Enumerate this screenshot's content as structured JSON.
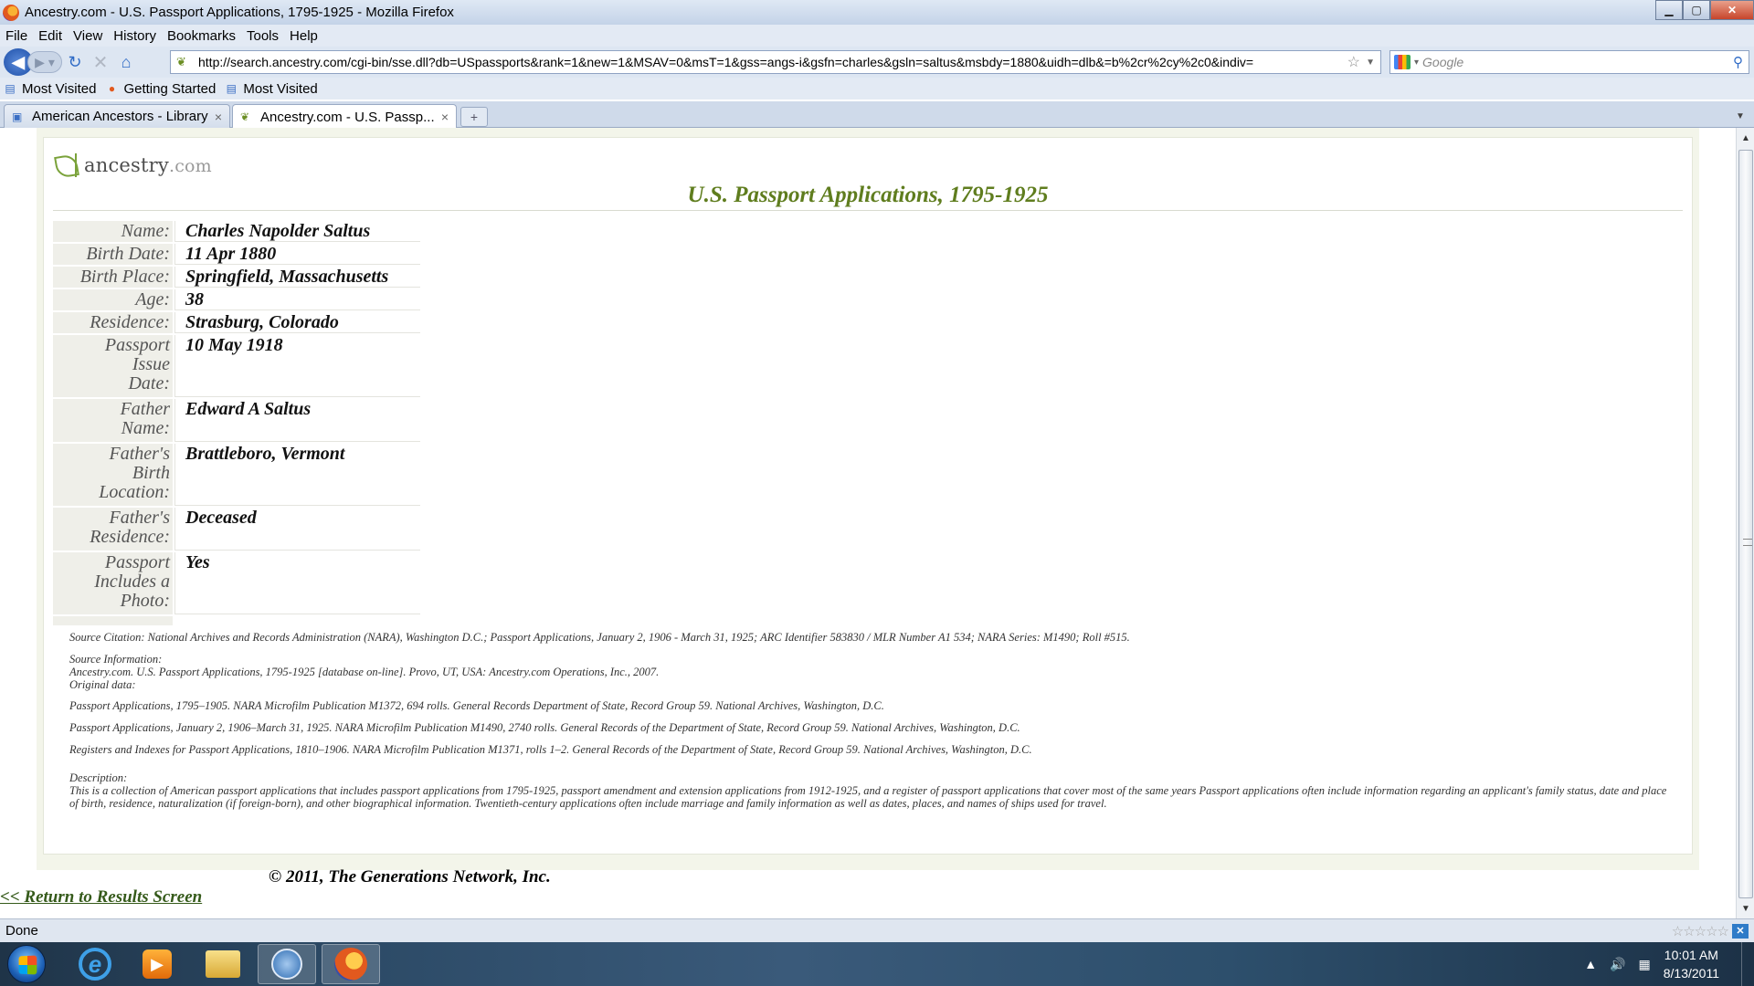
{
  "window": {
    "title": "Ancestry.com - U.S. Passport Applications, 1795-1925 - Mozilla Firefox",
    "minimize": "▁",
    "maximize": "▢",
    "close": "✕"
  },
  "menu": [
    "File",
    "Edit",
    "View",
    "History",
    "Bookmarks",
    "Tools",
    "Help"
  ],
  "navbar": {
    "url": "http://search.ancestry.com/cgi-bin/sse.dll?db=USpassports&rank=1&new=1&MSAV=0&msT=1&gss=angs-i&gsfn=charles&gsln=saltus&msbdy=1880&uidh=dlb&=b%2cr%2cy%2c0&indiv=",
    "search_placeholder": "Google"
  },
  "bookmarks": [
    "Most Visited",
    "Getting Started",
    "Most Visited"
  ],
  "tabs": [
    {
      "label": "American Ancestors - Library",
      "active": false
    },
    {
      "label": "Ancestry.com - U.S. Passp...",
      "active": true
    }
  ],
  "page": {
    "logo_main": "ancestry",
    "logo_suffix": ".com",
    "title": "U.S. Passport Applications, 1795-1925",
    "record": [
      {
        "label": "Name:",
        "value": "Charles Napolder Saltus"
      },
      {
        "label": "Birth Date:",
        "value": "11 Apr 1880"
      },
      {
        "label": "Birth Place:",
        "value": "Springfield, Massachusetts"
      },
      {
        "label": "Age:",
        "value": "38"
      },
      {
        "label": "Residence:",
        "value": "Strasburg, Colorado"
      },
      {
        "label": "Passport Issue Date:",
        "value": "10 May 1918"
      },
      {
        "label": "Father Name:",
        "value": "Edward A Saltus"
      },
      {
        "label": "Father's Birth Location:",
        "value": "Brattleboro, Vermont"
      },
      {
        "label": "Father's Residence:",
        "value": "Deceased"
      },
      {
        "label": "Passport Includes a Photo:",
        "value": "Yes"
      }
    ],
    "source_citation": "Source Citation: National Archives and Records Administration (NARA), Washington D.C.; Passport Applications, January 2, 1906 - March 31, 1925; ARC Identifier 583830 / MLR Number A1 534; NARA Series: M1490; Roll #515.",
    "source_info_heading": "Source Information:",
    "source_info_text": "Ancestry.com. U.S. Passport Applications, 1795-1925 [database on-line]. Provo, UT, USA: Ancestry.com Operations, Inc., 2007.",
    "original_data_heading": "Original data:",
    "original_data": [
      "Passport Applications, 1795–1905. NARA Microfilm Publication M1372, 694 rolls. General Records Department of State, Record Group 59. National Archives, Washington, D.C.",
      "Passport Applications, January 2, 1906–March 31, 1925. NARA Microfilm Publication M1490, 2740 rolls. General Records of the Department of State, Record Group 59. National Archives, Washington, D.C.",
      "Registers and Indexes for Passport Applications, 1810–1906. NARA Microfilm Publication M1371, rolls 1–2. General Records of the Department of State, Record Group 59. National Archives, Washington, D.C."
    ],
    "description_heading": "Description:",
    "description_text": "This is a collection of American passport applications that includes passport applications from 1795-1925, passport amendment and extension applications from 1912-1925, and a register of passport applications that cover most of the same years Passport applications often include information regarding an applicant's family status, date and place of birth, residence, naturalization (if foreign-born), and other biographical information. Twentieth-century applications often include marriage and family information as well as dates, places, and names of ships used for travel.",
    "copyright": "© 2011, The Generations Network, Inc.",
    "return_link": "<< Return to Results Screen"
  },
  "status": {
    "text": "Done"
  },
  "taskbar": {
    "time": "10:01 AM",
    "date": "8/13/2011"
  }
}
